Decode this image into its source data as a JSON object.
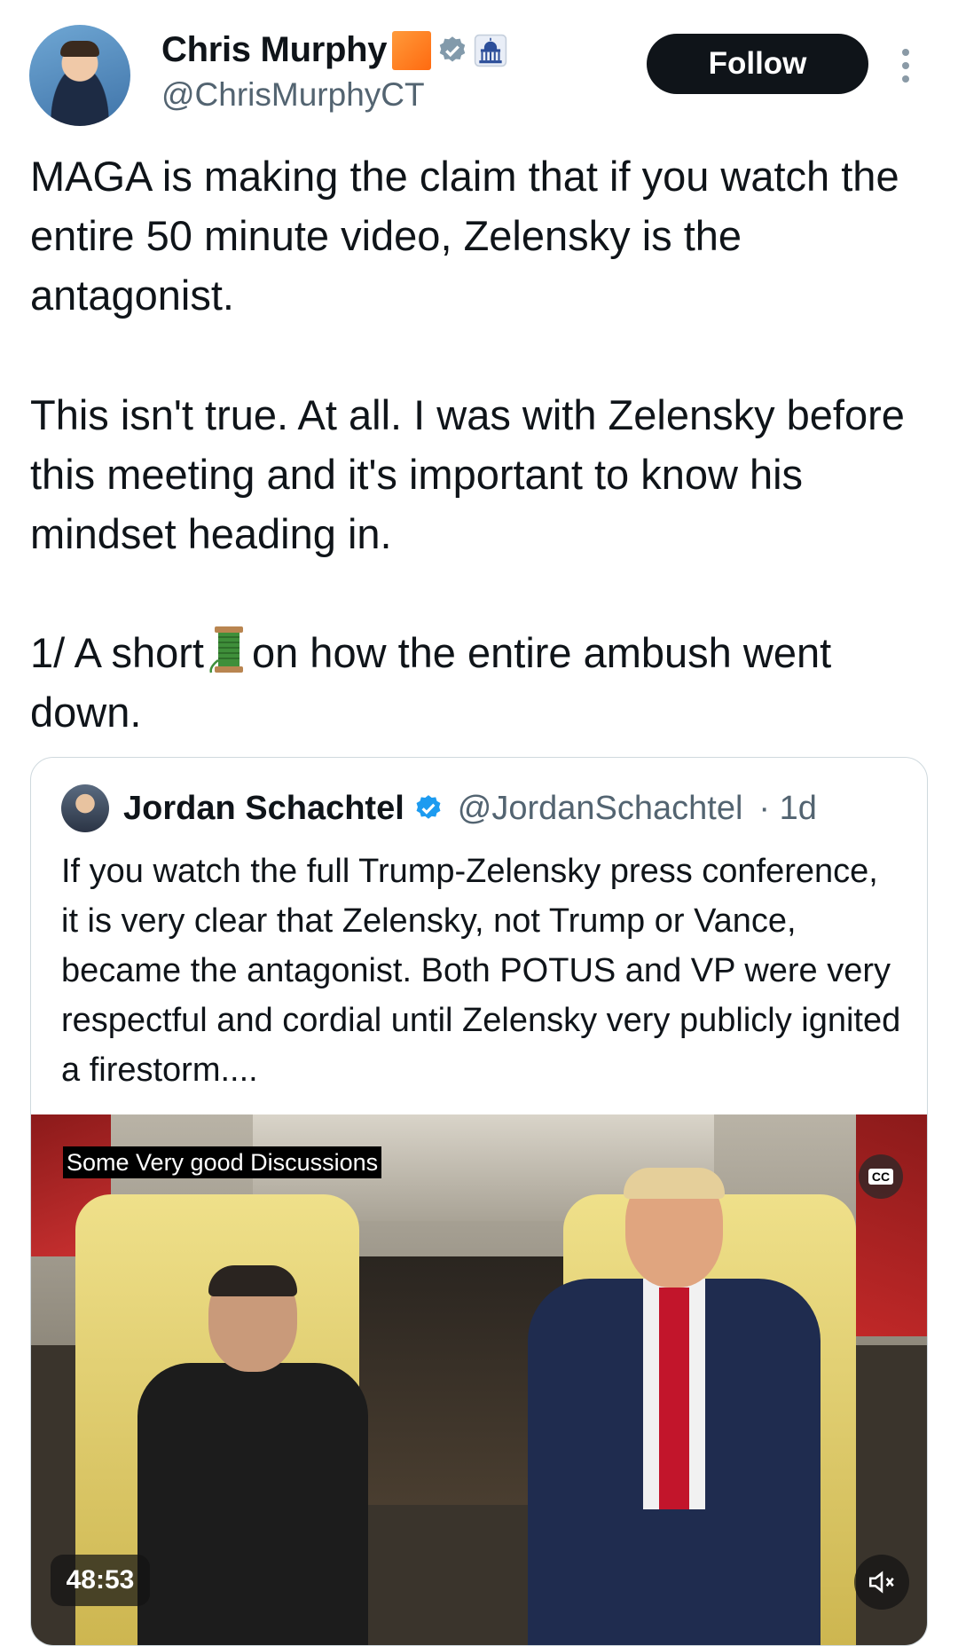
{
  "author": {
    "name": "Chris Murphy",
    "handle": "@ChrisMurphyCT",
    "follow_label": "Follow",
    "icons": [
      "orange-square-emoji",
      "verified-badge-icon",
      "capitol-affiliation-icon"
    ]
  },
  "tweet": {
    "paragraph1": "MAGA is making the claim that if you watch the entire 50 minute video, Zelensky is the antagonist.",
    "paragraph2": "This isn't true. At all. I was with Zelensky before this meeting and it's important to know his mindset heading in.",
    "paragraph3_before": "1/ A short",
    "paragraph3_after": "on how the entire ambush went down."
  },
  "quoted_tweet": {
    "name": "Jordan Schachtel",
    "handle": "@JordanSchachtel",
    "time": "· 1d",
    "text": "If you watch the full Trump-Zelensky press conference, it is very clear that Zelensky, not Trump or Vance, became the antagonist. Both POTUS and VP were very respectful and cordial until Zelensky very publicly ignited a firestorm....",
    "video": {
      "caption": "Some Very good Discussions",
      "cc_label": "CC",
      "duration": "48:53"
    }
  },
  "colors": {
    "text": "#0f1419",
    "secondary": "#536471",
    "verified": "#1d9bf0",
    "border": "#cfd9de"
  }
}
